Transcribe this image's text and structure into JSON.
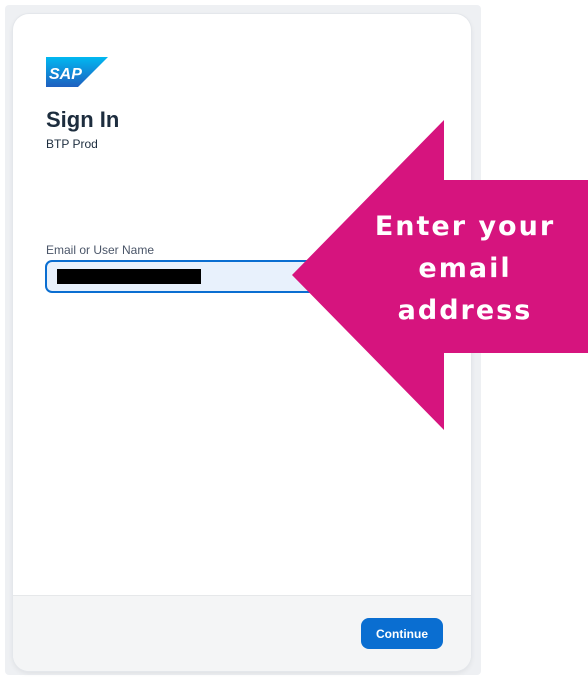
{
  "brand": {
    "logo_text": "SAP"
  },
  "header": {
    "title": "Sign In",
    "subtitle": "BTP Prod"
  },
  "form": {
    "email_label": "Email or User Name",
    "email_value_redacted": true
  },
  "footer": {
    "continue_label": "Continue"
  },
  "annotation": {
    "lines": [
      "Enter your",
      "email",
      "address"
    ],
    "color": "#d6147e"
  },
  "colors": {
    "accent": "#0a6ed1",
    "heading": "#1d2d3e",
    "input_bg": "#e8f1fc"
  }
}
